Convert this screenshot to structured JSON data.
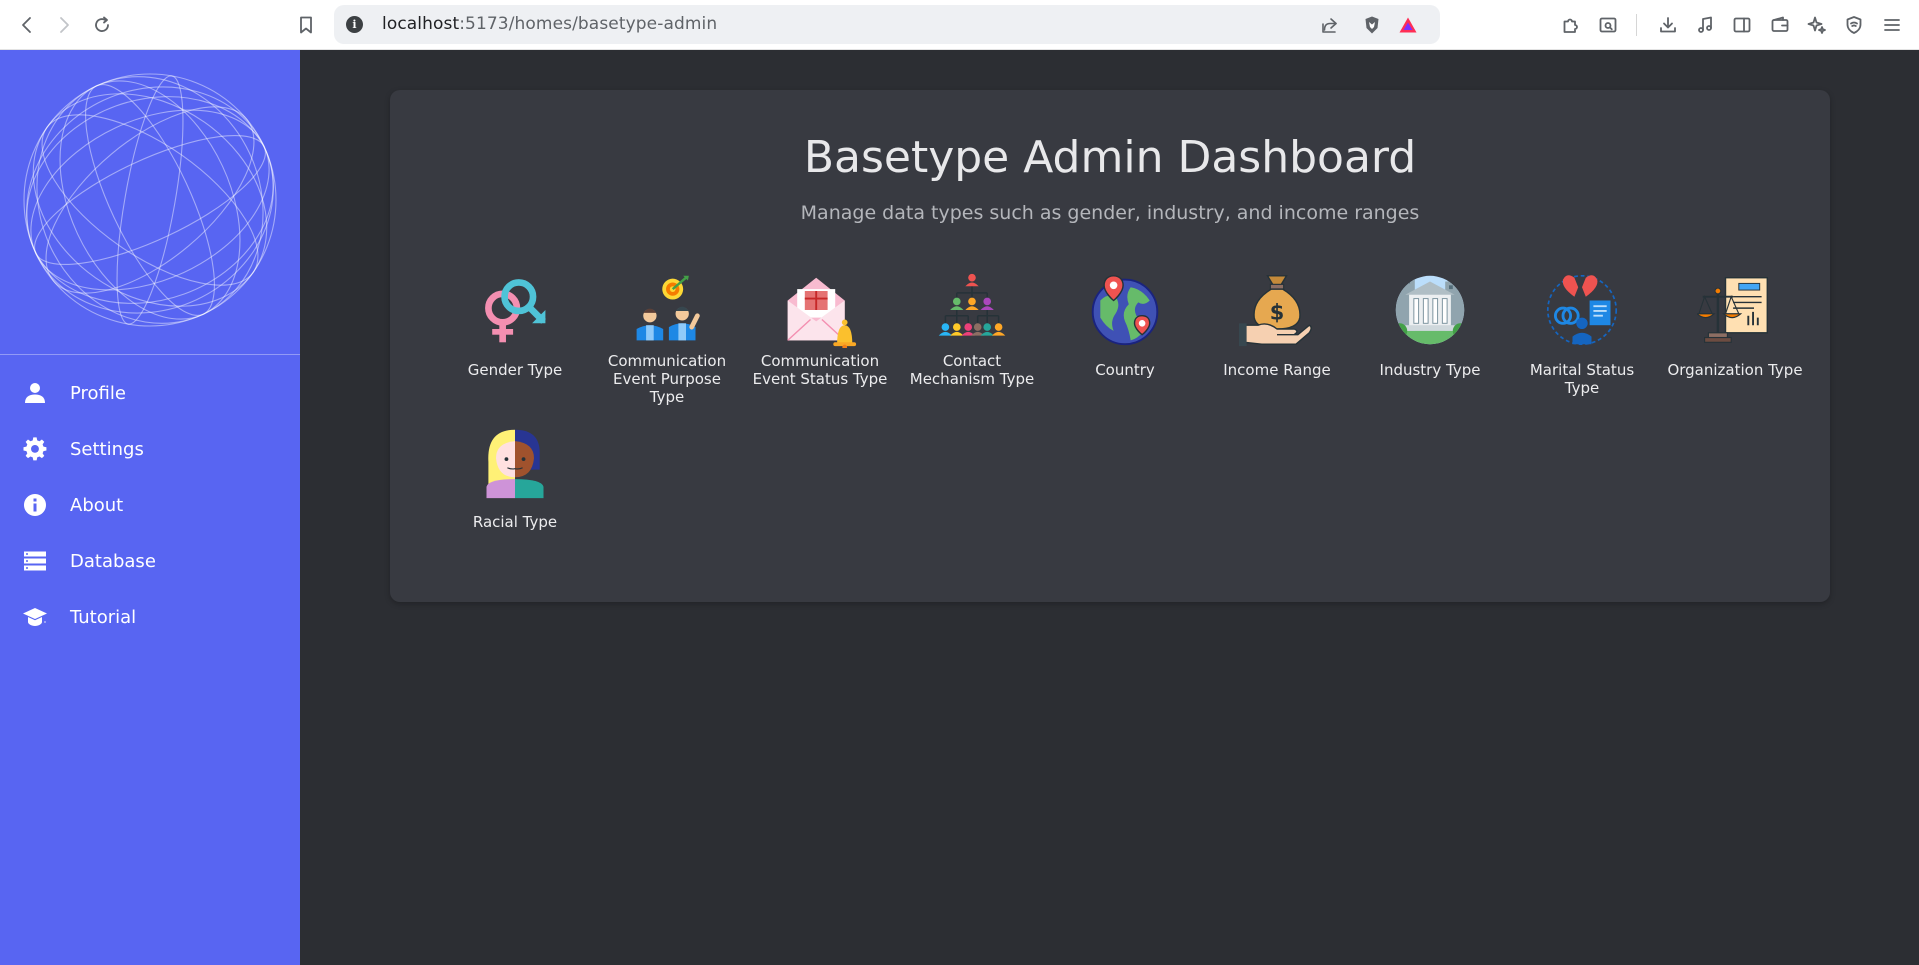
{
  "browser": {
    "url_host": "localhost",
    "url_path": ":5173/homes/basetype-admin",
    "back_icon": "back-arrow-icon",
    "forward_icon": "forward-arrow-icon",
    "reload_icon": "reload-icon"
  },
  "sidebar": {
    "items": [
      {
        "label": "Profile",
        "icon": "person-icon"
      },
      {
        "label": "Settings",
        "icon": "gear-icon"
      },
      {
        "label": "About",
        "icon": "info-icon"
      },
      {
        "label": "Database",
        "icon": "database-icon"
      },
      {
        "label": "Tutorial",
        "icon": "graduation-cap-icon"
      }
    ]
  },
  "main": {
    "title": "Basetype Admin Dashboard",
    "subtitle": "Manage data types such as gender, industry, and income ranges",
    "tiles": [
      {
        "label": "Gender Type"
      },
      {
        "label": "Communication Event Purpose Type"
      },
      {
        "label": "Communication Event Status Type"
      },
      {
        "label": "Contact Mechanism Type"
      },
      {
        "label": "Country"
      },
      {
        "label": "Income Range"
      },
      {
        "label": "Industry Type"
      },
      {
        "label": "Marital Status Type"
      },
      {
        "label": "Organization Type"
      },
      {
        "label": "Racial Type"
      }
    ]
  },
  "colors": {
    "sidebar": "#5865f2",
    "background": "#2c2e33",
    "card": "#383a41"
  }
}
